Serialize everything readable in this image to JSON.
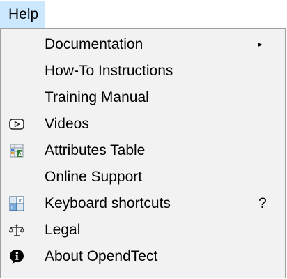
{
  "menubar": {
    "help_label": "Help"
  },
  "menu": {
    "items": [
      {
        "label": "Documentation",
        "submenu_arrow": "▸",
        "icon": "none"
      },
      {
        "label": "How-To Instructions",
        "icon": "none"
      },
      {
        "label": "Training Manual",
        "icon": "none"
      },
      {
        "label": "Videos",
        "icon": "video-play-icon"
      },
      {
        "label": "Attributes Table",
        "icon": "attributes-table-icon"
      },
      {
        "label": "Online Support",
        "icon": "none"
      },
      {
        "label": "Keyboard shortcuts",
        "shortcut": "?",
        "icon": "keyboard-shortcuts-icon"
      },
      {
        "label": "Legal",
        "icon": "scales-icon"
      },
      {
        "label": "About OpendTect",
        "icon": "info-icon"
      }
    ]
  },
  "colors": {
    "menubar_highlight": "#cce8ff",
    "menu_background": "#f2f2f2",
    "menu_border": "#a0a0a0"
  }
}
